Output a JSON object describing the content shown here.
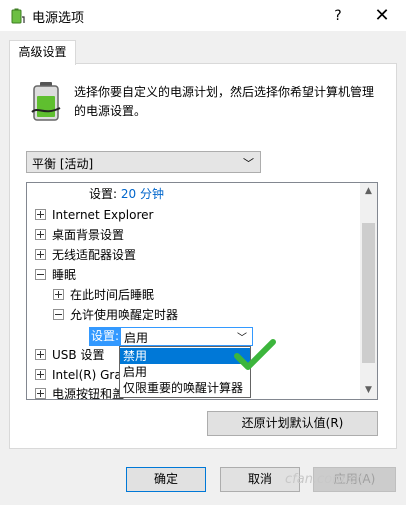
{
  "window": {
    "title": "电源选项",
    "help": "?",
    "close": "✕"
  },
  "tab": {
    "label": "高级设置"
  },
  "description": "选择你要自定义的电源计划，然后选择你希望计算机管理的电源设置。",
  "plan_select": {
    "value": "平衡 [活动]"
  },
  "tree": {
    "top_setting_label": "设置:",
    "top_setting_value": "20 分钟",
    "items": [
      {
        "label": "Internet Explorer"
      },
      {
        "label": "桌面背景设置"
      },
      {
        "label": "无线适配器设置"
      },
      {
        "label": "睡眠"
      },
      {
        "label": "在此时间后睡眠"
      },
      {
        "label": "允许使用唤醒定时器"
      },
      {
        "label": "USB 设置"
      },
      {
        "label": "Intel(R) Gra"
      },
      {
        "label": "电源按钮和盖"
      }
    ],
    "setting_label": "设置:",
    "setting_value": "启用",
    "dropdown_options": [
      "禁用",
      "启用",
      "仅限重要的唤醒计算器"
    ]
  },
  "buttons": {
    "restore": "还原计划默认值(R)",
    "ok": "确定",
    "cancel": "取消",
    "apply": "应用(A)"
  },
  "watermark": "cfan.com.cn",
  "colors": {
    "accent": "#0078d7",
    "selection": "#3399ff",
    "check": "#3cb53c"
  }
}
